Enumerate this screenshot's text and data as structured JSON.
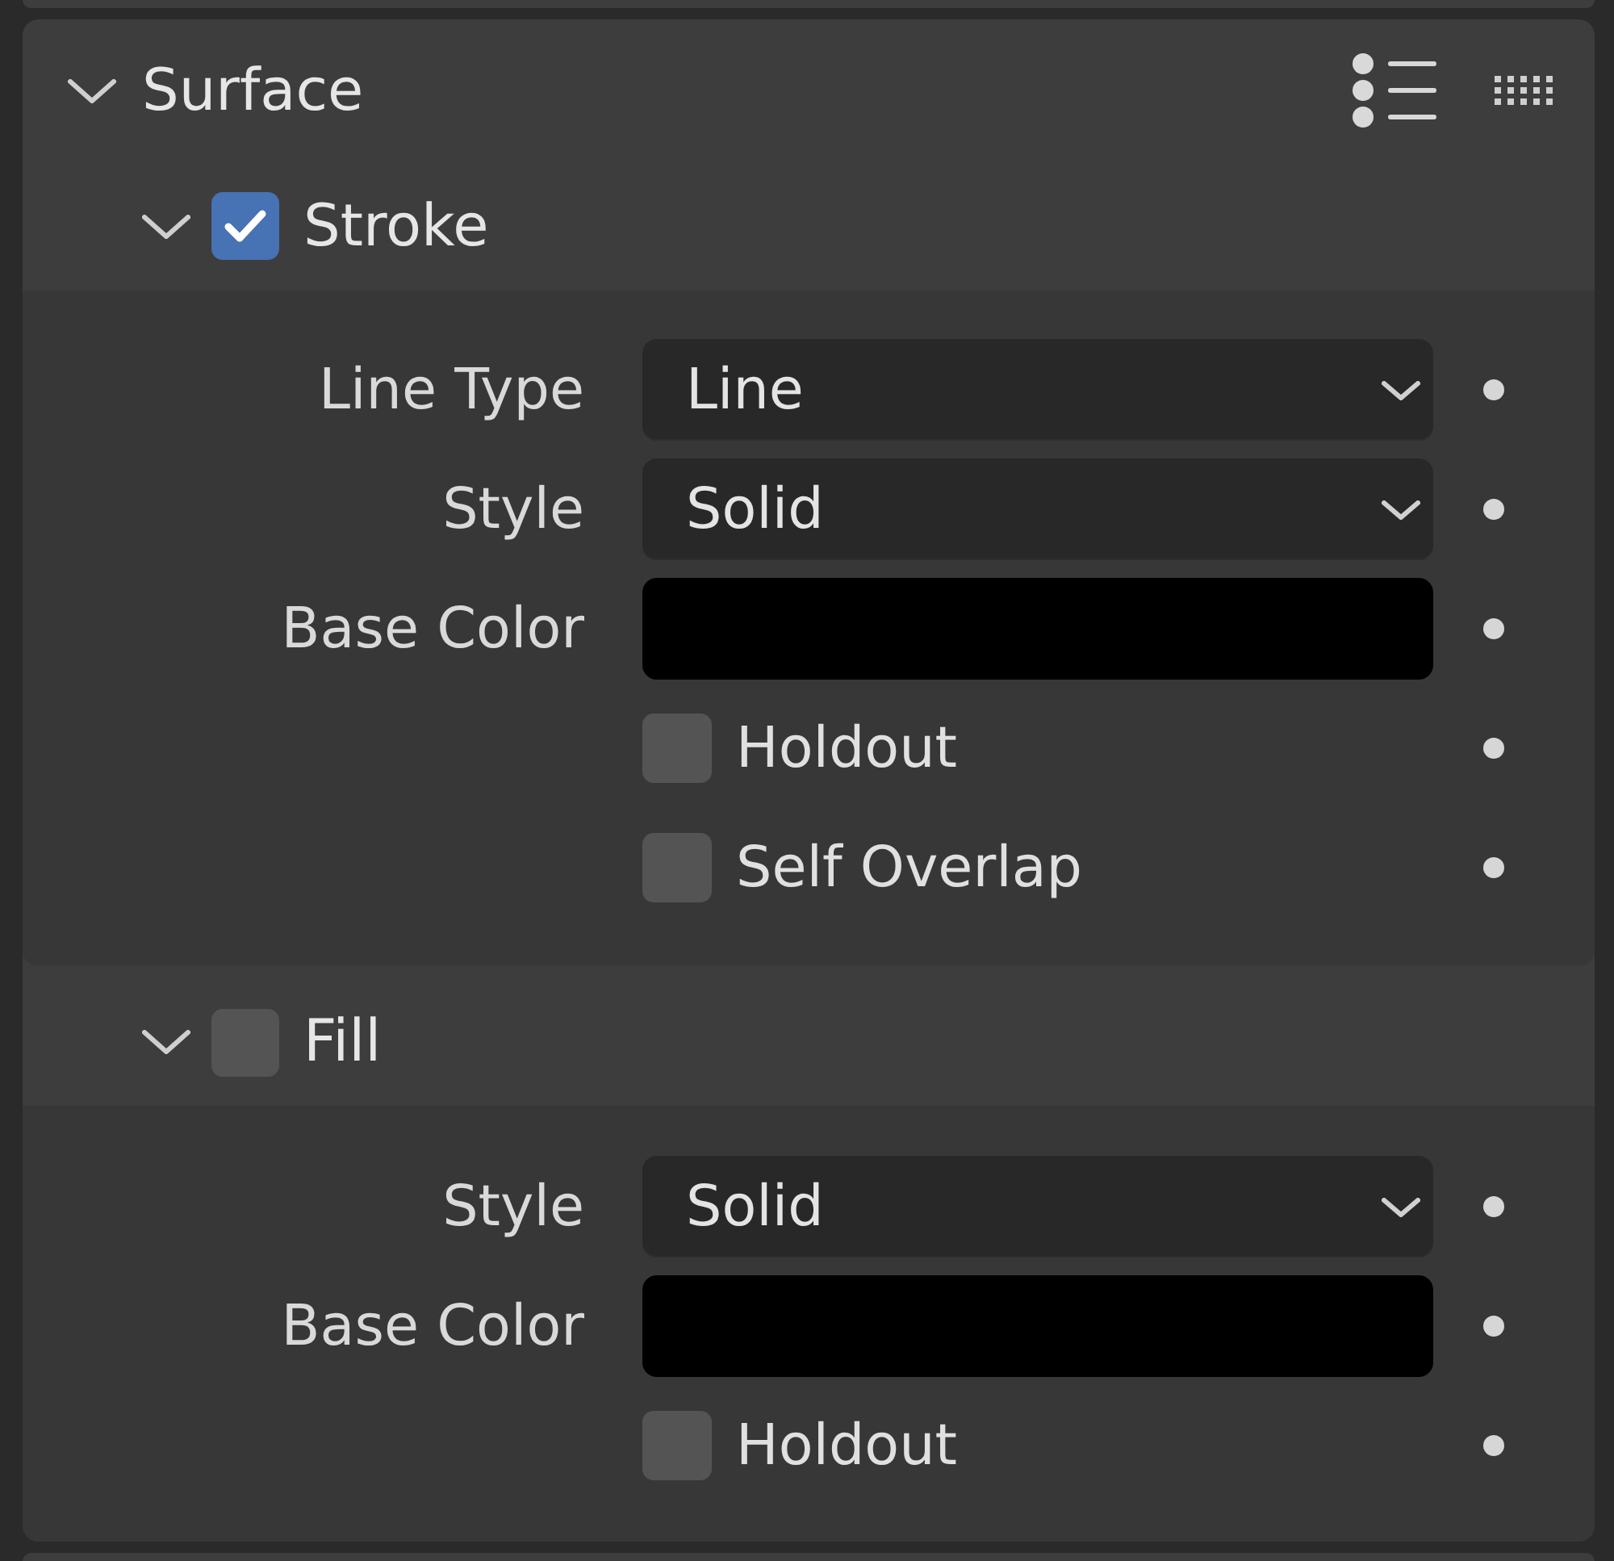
{
  "panel": {
    "title": "Surface",
    "expanded": true
  },
  "subpanels": [
    {
      "title": "Stroke",
      "expanded": true,
      "checked": true,
      "properties": [
        {
          "kind": "dropdown",
          "label": "Line Type",
          "value": "Line"
        },
        {
          "kind": "dropdown",
          "label": "Style",
          "value": "Solid"
        },
        {
          "kind": "color",
          "label": "Base Color",
          "color": "#000000"
        },
        {
          "kind": "checkbox",
          "label": "Holdout",
          "checked": false
        },
        {
          "kind": "checkbox",
          "label": "Self Overlap",
          "checked": false
        }
      ]
    },
    {
      "title": "Fill",
      "expanded": true,
      "checked": false,
      "properties": [
        {
          "kind": "dropdown",
          "label": "Style",
          "value": "Solid"
        },
        {
          "kind": "color",
          "label": "Base Color",
          "color": "#000000"
        },
        {
          "kind": "checkbox",
          "label": "Holdout",
          "checked": false
        }
      ]
    }
  ]
}
